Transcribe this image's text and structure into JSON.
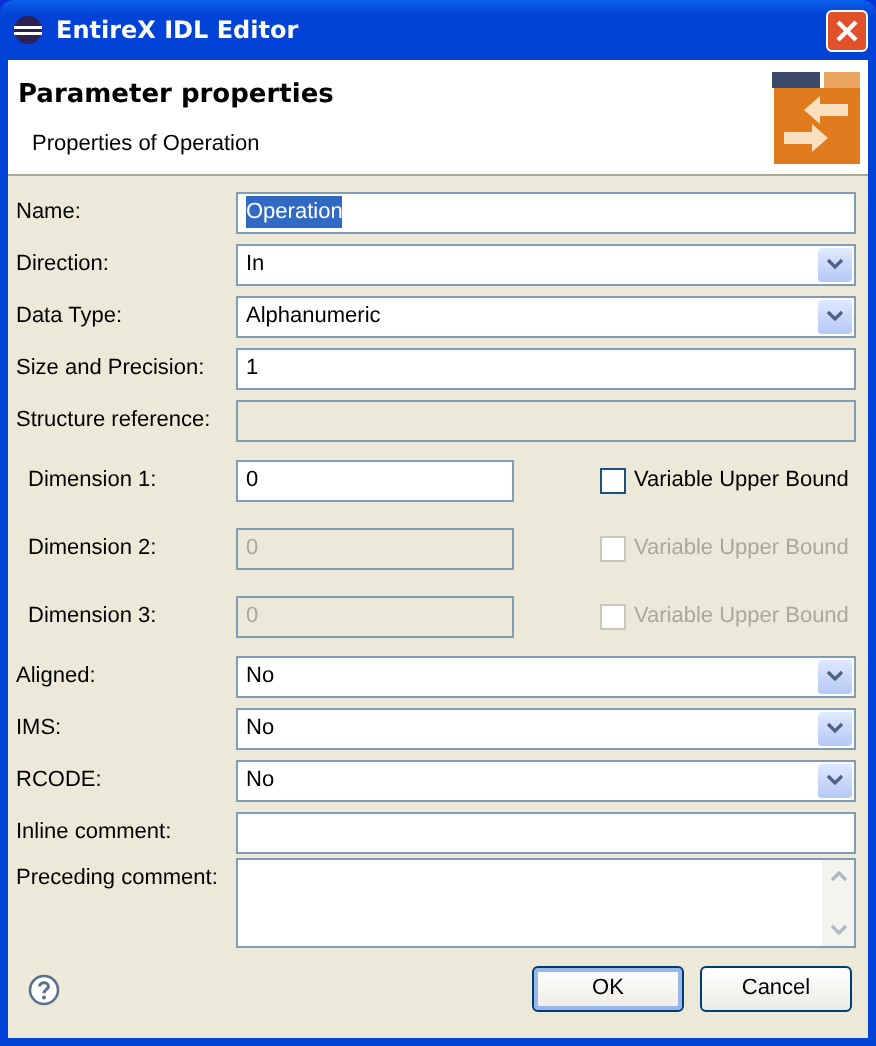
{
  "window": {
    "title": "EntireX IDL Editor"
  },
  "header": {
    "title": "Parameter properties",
    "subtitle": "Properties of Operation"
  },
  "fields": [
    {
      "kind": "text",
      "label": "Name:",
      "value": "Operation",
      "disabled": false,
      "text_selected": true
    },
    {
      "kind": "combo",
      "label": "Direction:",
      "value": "In",
      "disabled": false
    },
    {
      "kind": "combo",
      "label": "Data Type:",
      "value": "Alphanumeric",
      "disabled": false
    },
    {
      "kind": "text",
      "label": "Size and Precision:",
      "value": "1",
      "disabled": false
    },
    {
      "kind": "text",
      "label": "Structure reference:",
      "disabled": true
    },
    {
      "kind": "dimension",
      "label": "Dimension 1:",
      "value": "0",
      "disabled": false,
      "checkbox": {
        "label": "Variable Upper Bound",
        "checked": false
      }
    },
    {
      "kind": "dimension",
      "label": "Dimension 2:",
      "value": "0",
      "disabled": true,
      "checkbox": {
        "label": "Variable Upper Bound",
        "checked": false
      }
    },
    {
      "kind": "dimension",
      "label": "Dimension 3:",
      "value": "0",
      "disabled": true,
      "checkbox": {
        "label": "Variable Upper Bound",
        "checked": false
      }
    },
    {
      "kind": "combo",
      "label": "Aligned:",
      "value": "No",
      "disabled": false
    },
    {
      "kind": "combo",
      "label": "IMS:",
      "value": "No",
      "disabled": false
    },
    {
      "kind": "combo",
      "label": "RCODE:",
      "value": "No",
      "disabled": false
    },
    {
      "kind": "text",
      "label": "Inline comment:",
      "disabled": false
    },
    {
      "kind": "textarea",
      "label": "Preceding comment:",
      "disabled": false
    }
  ],
  "buttons": [
    {
      "label": "OK",
      "default": true
    },
    {
      "label": "Cancel",
      "default": false
    }
  ]
}
